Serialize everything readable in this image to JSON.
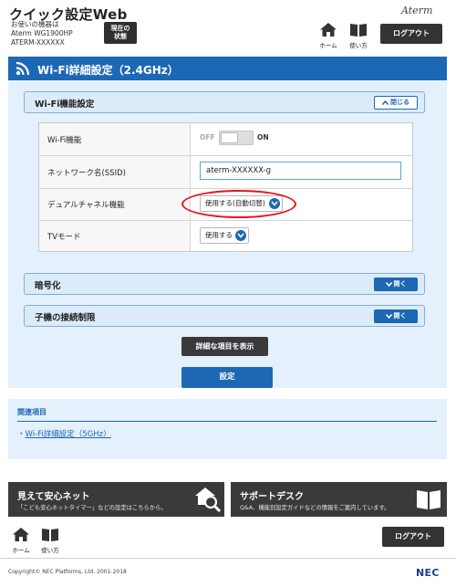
{
  "header": {
    "app_title": "クイック設定Web",
    "device_line1": "お使いの機器は",
    "device_line2": "Aterm WG1900HP",
    "device_line3": "ATERM-XXXXXX",
    "status_btn_line1": "現在の",
    "status_btn_line2": "状態",
    "brand": "Aterm",
    "nav_home": "ホーム",
    "nav_manual": "使い方",
    "logout": "ログアウト"
  },
  "section": {
    "title": "Wi-Fi詳細設定（2.4GHz）"
  },
  "groups": {
    "wifi_function": {
      "label": "Wi-Fi機能設定",
      "toggle": "閉じる"
    },
    "encryption": {
      "label": "暗号化",
      "toggle": "開く"
    },
    "child_limit": {
      "label": "子機の接続制限",
      "toggle": "開く"
    }
  },
  "rows": {
    "wifi_function": {
      "label": "Wi-Fi機能",
      "off": "OFF",
      "on": "ON"
    },
    "ssid": {
      "label": "ネットワーク名(SSID)",
      "value": "aterm-XXXXXX-g"
    },
    "dual_channel": {
      "label": "デュアルチャネル機能",
      "value": "使用する(自動切替)"
    },
    "tv_mode": {
      "label": "TVモード",
      "value": "使用する"
    }
  },
  "buttons": {
    "advanced": "詳細な項目を表示",
    "apply": "設定"
  },
  "related": {
    "title": "関連項目",
    "link_bullet": "・",
    "link": "Wi-Fi詳細設定（5GHz）"
  },
  "banners": {
    "safety": {
      "title": "見えて安心ネット",
      "desc": "「こども安心ネットタイマー」などの設定はこちらから。"
    },
    "support": {
      "title": "サポートデスク",
      "desc": "Q&A、機能別設定ガイドなどの情報をご案内しています。"
    }
  },
  "footer": {
    "nav_home": "ホーム",
    "nav_manual": "使い方",
    "logout": "ログアウト",
    "copyright": "Copyright© NEC Platforms, Ltd. 2001-2018",
    "brand": "NEC"
  },
  "colors": {
    "primary_blue": "#1c68b4",
    "panel_bg": "#e4f0fb",
    "dark_button": "#3a3a3a",
    "highlight_red": "#e8141b"
  },
  "icons": {
    "home": "home-icon",
    "manual": "book-icon",
    "wifi": "wifi-icon",
    "chevron": "chevron-icon",
    "house_search": "house-search-icon",
    "support_book": "open-book-icon"
  }
}
